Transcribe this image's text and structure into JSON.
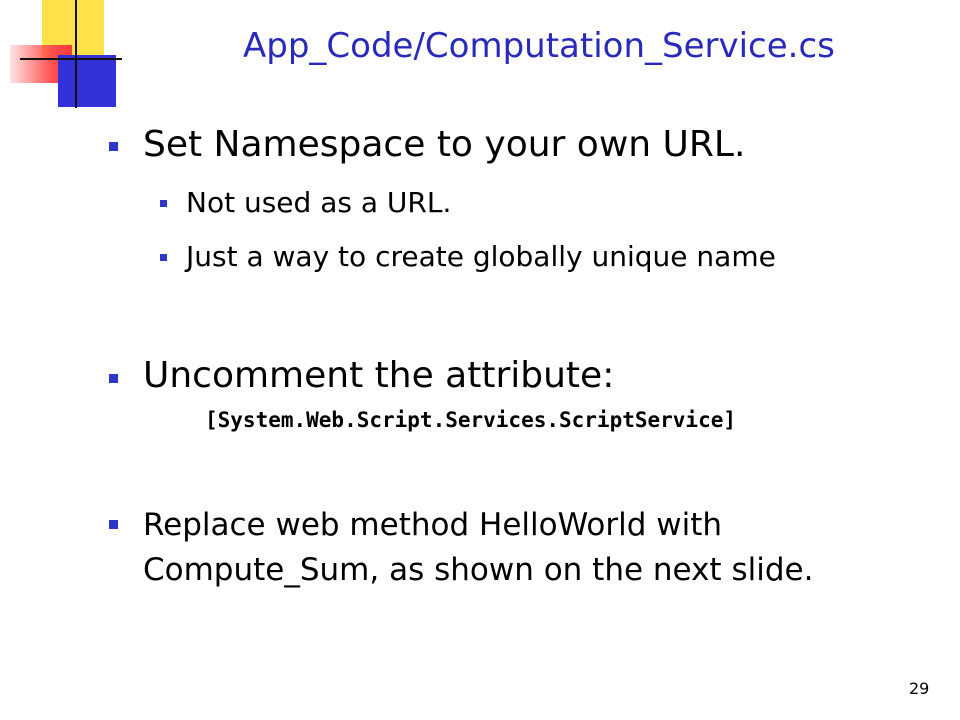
{
  "slide": {
    "title": "App_Code/Computation_Service.cs",
    "bullets": {
      "b1": "Set Namespace to your own URL.",
      "b1_sub1": "Not used as a URL.",
      "b1_sub2": "Just a way to create globally unique name",
      "b2": "Uncomment the attribute:",
      "b2_code": "[System.Web.Script.Services.ScriptService]",
      "b3_line1": "Replace web method HelloWorld with",
      "b3_line2": "Compute_Sum, as shown on the next slide."
    },
    "page_number": "29"
  },
  "colors": {
    "title": "#2a2ab8",
    "bullet": "#2e36c8",
    "deco_yellow": "#ffe14a",
    "deco_red": "#ff4d4d",
    "deco_blue": "#3232d8"
  }
}
